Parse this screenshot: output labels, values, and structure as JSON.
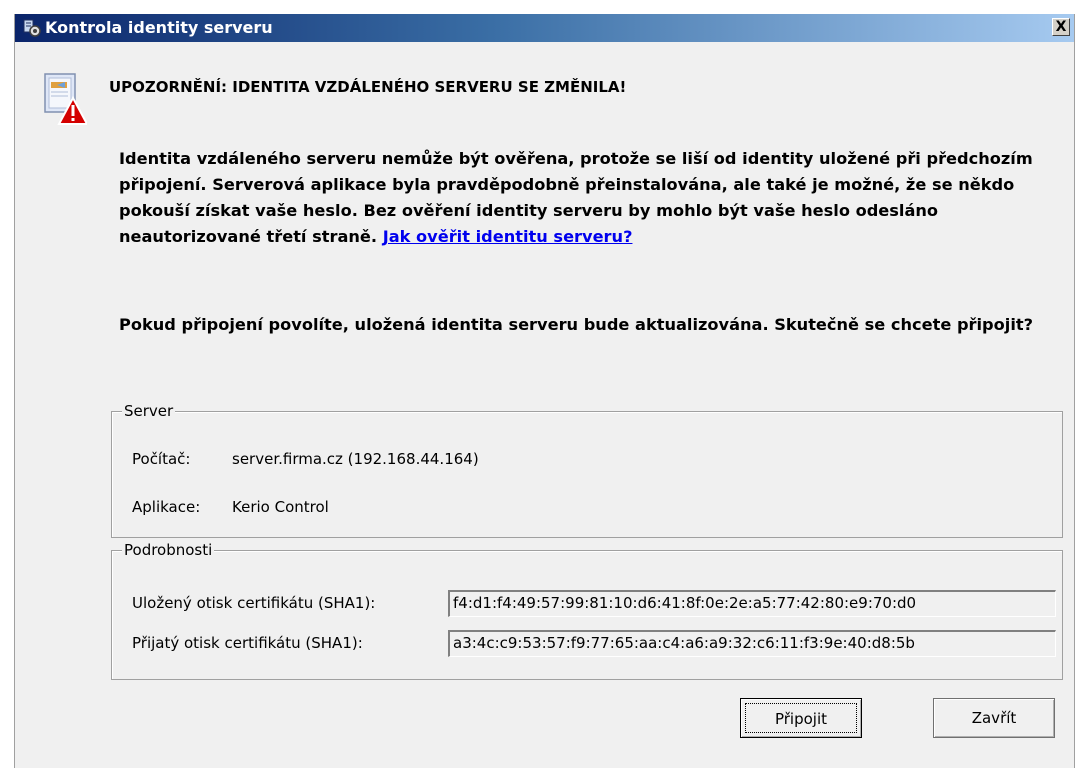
{
  "window": {
    "title": "Kontrola identity serveru",
    "close_label": "X"
  },
  "warning": {
    "heading": "UPOZORNĚNÍ: IDENTITA VZDÁLENÉHO SERVERU SE ZMĚNILA!",
    "paragraph1": "Identita vzdáleného serveru nemůže být ověřena, protože se liší od identity uložené při předchozím připojení. Serverová aplikace byla pravděpodobně přeinstalována, ale také je možné, že se někdo pokouší získat vaše heslo. Bez ověření identity serveru by mohlo být vaše heslo odesláno neautorizované třetí straně.",
    "link": "Jak ověřit identitu serveru?",
    "paragraph2": "Pokud připojení povolíte, uložená identita serveru bude aktualizována. Skutečně se chcete připojit?"
  },
  "server": {
    "legend": "Server",
    "computer_label": "Počítač:",
    "computer_value": "server.firma.cz (192.168.44.164)",
    "application_label": "Aplikace:",
    "application_value": "Kerio Control"
  },
  "details": {
    "legend": "Podrobnosti",
    "stored_label": "Uložený otisk certifikátu (SHA1):",
    "stored_value": "f4:d1:f4:49:57:99:81:10:d6:41:8f:0e:2e:a5:77:42:80:e9:70:d0",
    "received_label": "Přijatý otisk certifikátu (SHA1):",
    "received_value": "a3:4c:c9:53:57:f9:77:65:aa:c4:a6:a9:32:c6:11:f3:9e:40:d8:5b"
  },
  "buttons": {
    "connect": "Připojit",
    "close": "Zavřít"
  },
  "icons": {
    "title": "server-gear-icon",
    "warning": "certificate-warning-icon",
    "close": "close-icon"
  },
  "colors": {
    "titlebar_start": "#0a246a",
    "titlebar_end": "#a6caf0",
    "link": "#0000ee",
    "warning_red": "#d40000"
  }
}
